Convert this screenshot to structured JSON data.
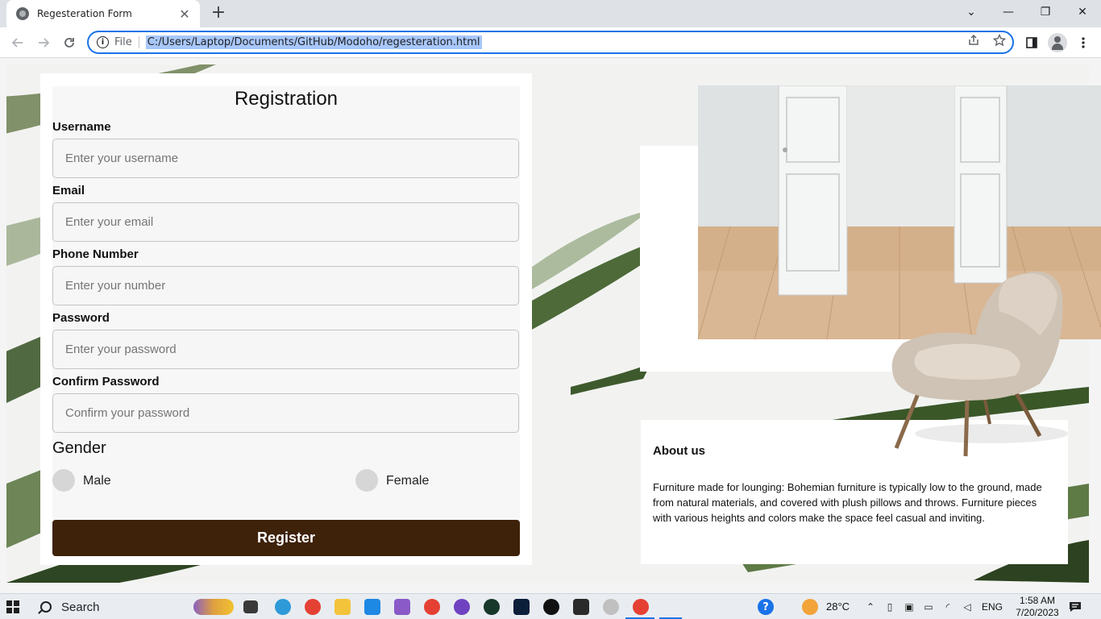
{
  "browser": {
    "tab_title": "Regesteration Form",
    "tab_close": "✕",
    "new_tab": "+",
    "scheme_label": "File",
    "url": "C:/Users/Laptop/Documents/GitHub/Modoho/regesteration.html",
    "window_controls": {
      "dropdown": "⌄",
      "minimize": "—",
      "restore": "❐",
      "close": "✕"
    }
  },
  "form": {
    "title": "Registration",
    "fields": [
      {
        "label": "Username",
        "placeholder": "Enter your username"
      },
      {
        "label": "Email",
        "placeholder": "Enter your email"
      },
      {
        "label": "Phone Number",
        "placeholder": "Enter your number"
      },
      {
        "label": "Password",
        "placeholder": "Enter your password"
      },
      {
        "label": "Confirm Password",
        "placeholder": "Confirm your password"
      }
    ],
    "gender_title": "Gender",
    "gender_options": [
      "Male",
      "Female"
    ],
    "submit_label": "Register",
    "submit_color": "#3e2209"
  },
  "about": {
    "title": "About us",
    "text": "Furniture made for lounging: Bohemian furniture is typically low to the ground, made from natural materials, and covered with plush pillows and throws. Furniture pieces with various heights and colors make the space feel casual and inviting."
  },
  "taskbar": {
    "search_label": "Search",
    "weather": "28°C",
    "language": "ENG",
    "time": "1:58 AM",
    "date": "7/20/2023",
    "help": "?"
  }
}
